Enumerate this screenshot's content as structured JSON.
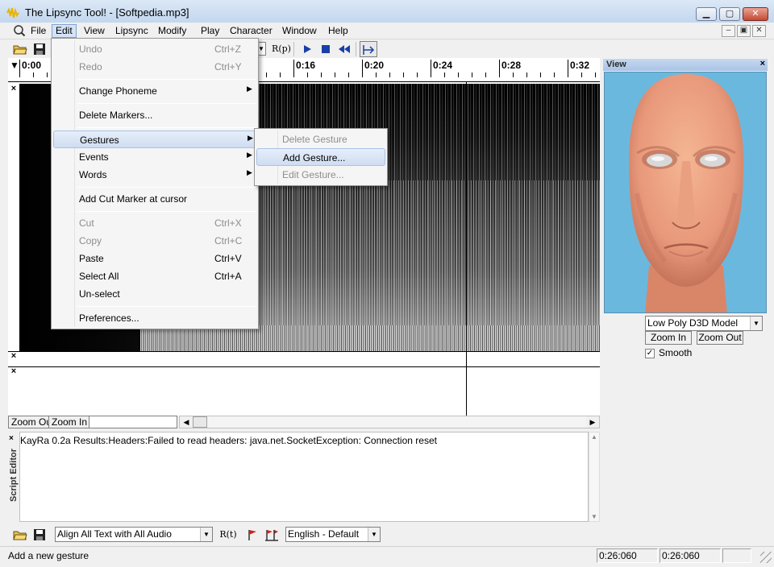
{
  "window": {
    "title": "The Lipsync Tool! - [Softpedia.mp3]",
    "buttons": {
      "minimize": "▁",
      "maximize": "▢",
      "close": "✕"
    }
  },
  "menubar": {
    "items": [
      "File",
      "Edit",
      "View",
      "Lipsync",
      "Modify",
      "Play",
      "Character",
      "Window",
      "Help"
    ],
    "open_menu": "Edit",
    "mdi_buttons": [
      "–",
      "▣",
      "✕"
    ]
  },
  "toolbar": {
    "rp_label": "R(p)"
  },
  "timeline": {
    "marker": "▼",
    "ticks": [
      "0:00",
      "0:16",
      "0:20",
      "0:24",
      "0:28",
      "0:32"
    ]
  },
  "tracks": {
    "close_glyph": "×"
  },
  "zoom": {
    "zoom_out": "Zoom Out",
    "zoom_in": "Zoom In"
  },
  "script_editor": {
    "tab_label": "Script Editor",
    "close_glyph": "×",
    "text": "KayRa 0.2a Results:Headers:Failed to read headers: java.net.SocketException: Connection reset"
  },
  "bottom_toolbar": {
    "align_option": "Align All Text with All Audio",
    "language_option": "English - Default",
    "r_label": "R(t)"
  },
  "statusbar": {
    "message": "Add a new gesture",
    "time1": "0:26:060",
    "time2": "0:26:060"
  },
  "view_panel": {
    "title": "View",
    "close_glyph": "×",
    "model_option": "Low Poly D3D Model",
    "zoom_in": "Zoom In",
    "zoom_out": "Zoom Out",
    "smooth_label": "Smooth",
    "smooth_checked": true,
    "background_color": "#6bb8df",
    "face_color": "#f0a684"
  },
  "edit_menu": {
    "items": [
      {
        "label": "Undo",
        "shortcut": "Ctrl+Z",
        "disabled": true
      },
      {
        "label": "Redo",
        "shortcut": "Ctrl+Y",
        "disabled": true
      },
      {
        "label": "Change Phoneme",
        "submenu": true
      },
      {
        "label": "Delete Markers..."
      },
      {
        "label": "Gestures",
        "submenu": true,
        "highlighted": true
      },
      {
        "label": "Events",
        "submenu": true
      },
      {
        "label": "Words",
        "submenu": true
      },
      {
        "label": "Add Cut Marker at cursor"
      },
      {
        "label": "Cut",
        "shortcut": "Ctrl+X",
        "disabled": true
      },
      {
        "label": "Copy",
        "shortcut": "Ctrl+C",
        "disabled": true
      },
      {
        "label": "Paste",
        "shortcut": "Ctrl+V"
      },
      {
        "label": "Select All",
        "shortcut": "Ctrl+A"
      },
      {
        "label": "Un-select"
      },
      {
        "label": "Preferences..."
      }
    ]
  },
  "gesture_submenu": {
    "items": [
      {
        "label": "Delete Gesture",
        "disabled": true
      },
      {
        "label": "Add Gesture...",
        "highlighted": true
      },
      {
        "label": "Edit Gesture...",
        "disabled": true
      }
    ]
  }
}
